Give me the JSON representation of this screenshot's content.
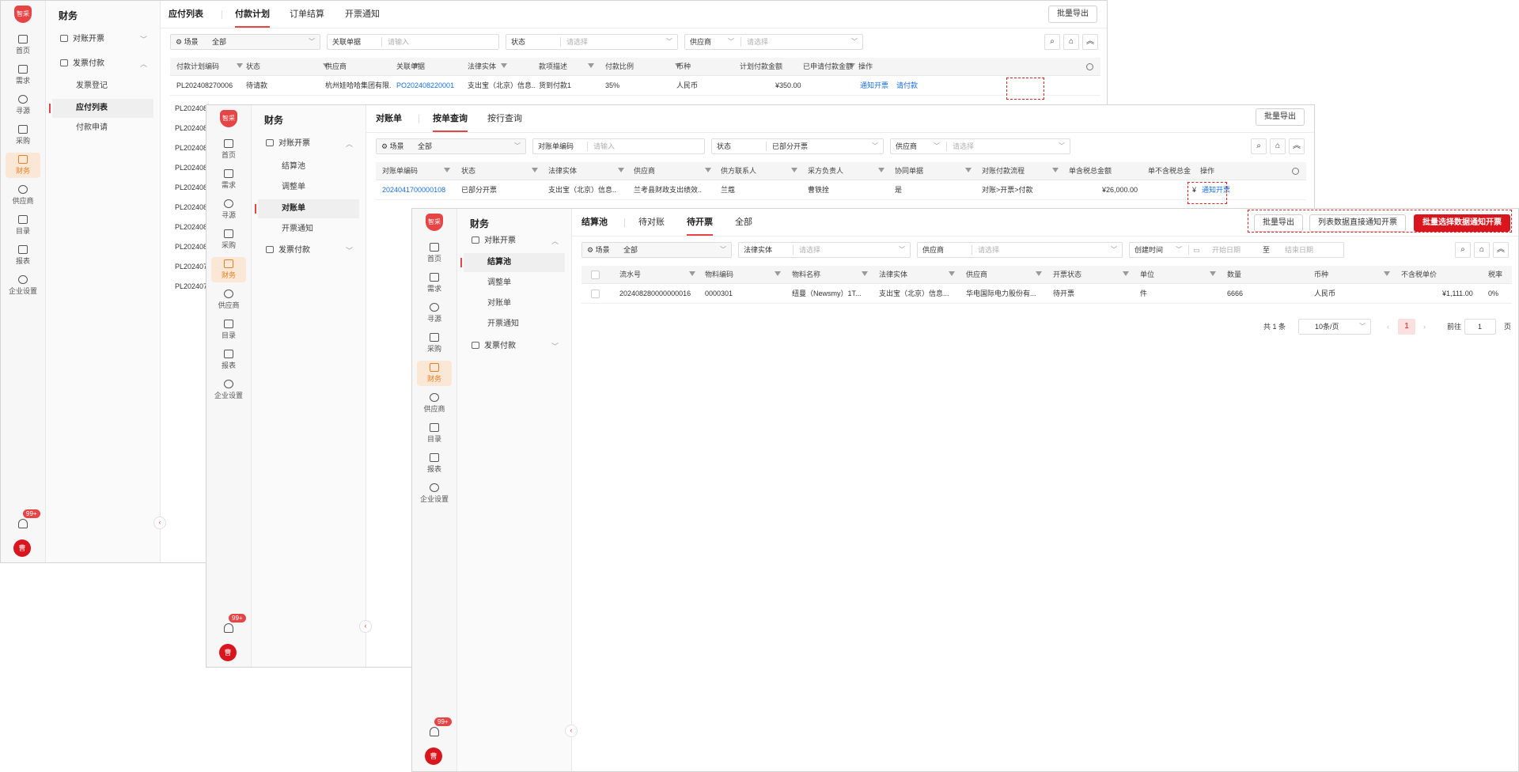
{
  "sidebar": {
    "logo_text": "智采",
    "items": [
      "首页",
      "需求",
      "寻源",
      "采购",
      "财务",
      "供应商",
      "目录",
      "报表",
      "企业设置"
    ],
    "active": "财务",
    "badge": "99+",
    "avatar_text": "曹"
  },
  "submenu": {
    "title": "财务",
    "group1": "对账开票",
    "group1_items": [
      "结算池",
      "调整单",
      "对账单",
      "开票通知"
    ],
    "group2": "发票付款",
    "group2_items": [
      "发票登记",
      "应付列表",
      "付款申请"
    ]
  },
  "w1": {
    "tabs": [
      "应付列表",
      "付款计划",
      "订单结算",
      "开票通知"
    ],
    "export_btn": "批量导出",
    "filters": {
      "scene_label": "场景",
      "scene_value": "全部",
      "rel_label": "关联单据",
      "rel_placeholder": "请输入",
      "status_label": "状态",
      "status_placeholder": "请选择",
      "supplier_label": "供应商",
      "supplier_placeholder": "请选择"
    },
    "columns": [
      "付款计划编码",
      "状态",
      "供应商",
      "关联单据",
      "法律实体",
      "款项描述",
      "付款比例",
      "币种",
      "计划付款金额",
      "已申请付款金额",
      "操作"
    ],
    "row": {
      "code": "PL202408270006",
      "status": "待请款",
      "supplier": "杭州娃哈哈集团有限...",
      "ref": "PO202408220001",
      "entity": "支出宝（北京）信息...",
      "desc": "货到付款1",
      "ratio": "35%",
      "currency": "人民币",
      "amount": "¥350.00",
      "action1": "通知开票",
      "action2": "请付款"
    },
    "row_codes": [
      "PL202408",
      "PL202408",
      "PL202408",
      "PL202408",
      "PL202408",
      "PL202408",
      "PL202408",
      "PL202408",
      "PL202407",
      "PL202407"
    ]
  },
  "w2": {
    "tabs": [
      "对账单",
      "按单查询",
      "按行查询"
    ],
    "export_btn": "批量导出",
    "filters": {
      "scene_label": "场景",
      "scene_value": "全部",
      "code_label": "对账单编码",
      "code_placeholder": "请输入",
      "status_label": "状态",
      "status_value": "已部分开票",
      "supplier_label": "供应商",
      "supplier_placeholder": "请选择"
    },
    "columns": [
      "对账单编码",
      "状态",
      "法律实体",
      "供应商",
      "供方联系人",
      "采方负责人",
      "协同单据",
      "对账付款流程",
      "单含税总金额",
      "单不含税总金",
      "操作"
    ],
    "row": {
      "code": "2024041700000108",
      "status": "已部分开票",
      "entity": "支出宝（北京）信息...",
      "supplier": "兰考县财政支出绩效...",
      "contact": "兰蔻",
      "owner": "曹铁拴",
      "collab": "是",
      "flow": "对账>开票>付款",
      "amount": "¥26,000.00",
      "amount2": "¥",
      "action": "通知开票"
    }
  },
  "w3": {
    "tabs": [
      "结算池",
      "待对账",
      "待开票",
      "全部"
    ],
    "btn_export": "批量导出",
    "btn_direct": "列表数据直接通知开票",
    "btn_batch": "批量选择数据通知开票",
    "filters": {
      "scene_label": "场景",
      "scene_value": "全部",
      "entity_label": "法律实体",
      "entity_placeholder": "请选择",
      "supplier_label": "供应商",
      "supplier_placeholder": "请选择",
      "date_label": "创建时间",
      "date_start": "开始日期",
      "date_to": "至",
      "date_end": "结束日期"
    },
    "columns": [
      "流水号",
      "物料编码",
      "物料名称",
      "法律实体",
      "供应商",
      "开票状态",
      "单位",
      "数量",
      "币种",
      "不含税单价",
      "税率"
    ],
    "row": {
      "serial": "202408280000000016",
      "mat_code": "0000301",
      "mat_name": "纽曼（Newsmy）1T...",
      "entity": "支出宝（北京）信息...",
      "supplier": "华电国际电力股份有...",
      "inv_status": "待开票",
      "unit": "件",
      "qty": "6666",
      "currency": "人民币",
      "price": "¥1,111.00",
      "tax": "0%"
    },
    "pagination": {
      "total": "共 1 条",
      "page_size": "10条/页",
      "current": "1",
      "goto_label": "前往",
      "goto_value": "1",
      "page_suffix": "页"
    }
  },
  "colors": {
    "accent": "#d9161d",
    "link": "#1a6fe0",
    "active_rail": "#e67e22"
  }
}
